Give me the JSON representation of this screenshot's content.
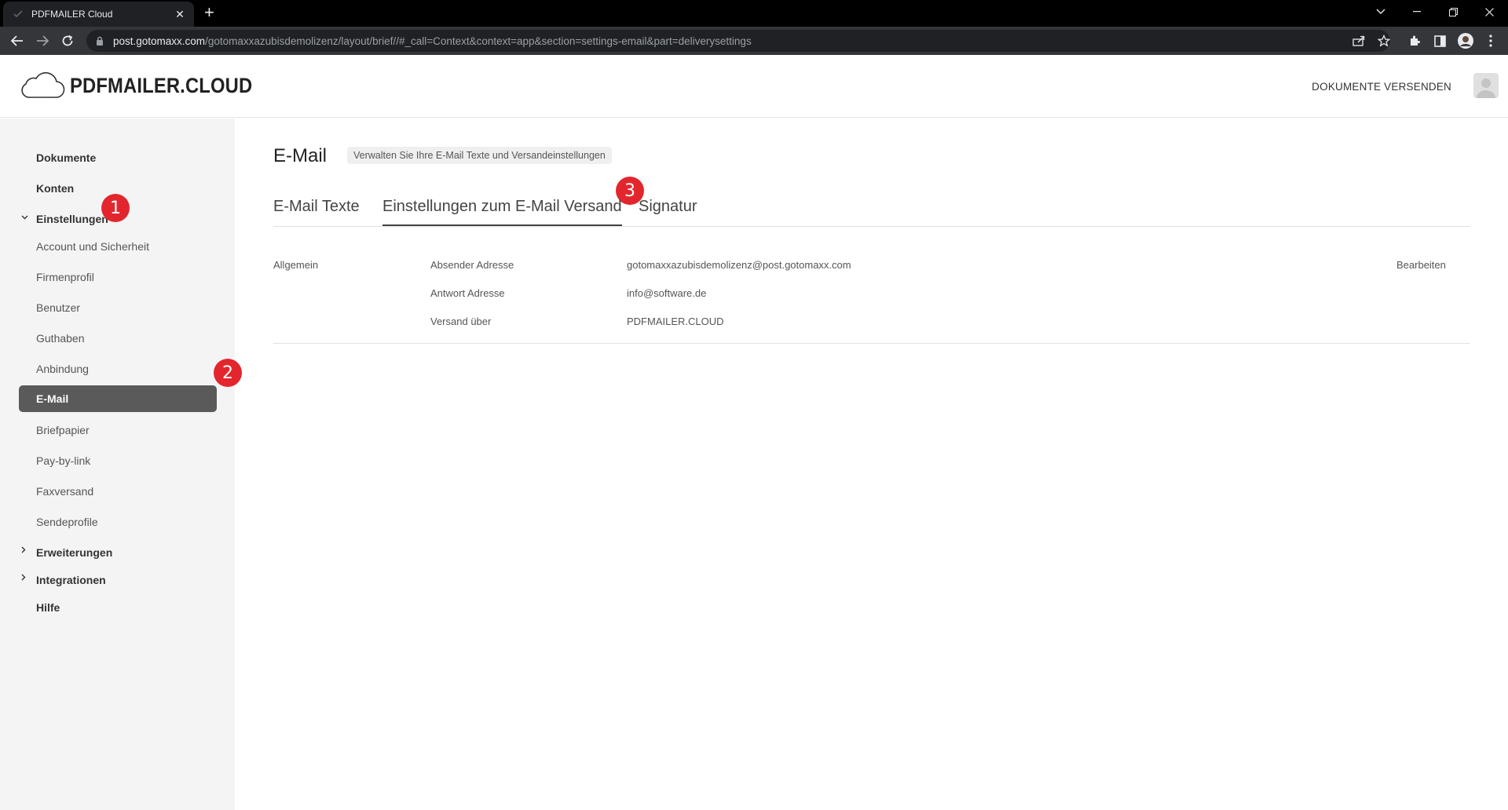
{
  "browser": {
    "tab_title": "PDFMAILER Cloud",
    "url_host": "post.gotomaxx.com",
    "url_path": "/gotomaxxazubisdemolizenz/layout/brief//#_call=Context&context=app&section=settings-email&part=deliverysettings"
  },
  "header": {
    "brand": "PDFMAILER.CLOUD",
    "send_documents": "DOKUMENTE VERSENDEN"
  },
  "sidebar": {
    "items": [
      {
        "label": "Dokumente"
      },
      {
        "label": "Konten"
      },
      {
        "label": "Einstellungen"
      },
      {
        "label": "Account und Sicherheit"
      },
      {
        "label": "Firmenprofil"
      },
      {
        "label": "Benutzer"
      },
      {
        "label": "Guthaben"
      },
      {
        "label": "Anbindung"
      },
      {
        "label": "E-Mail"
      },
      {
        "label": "Briefpapier"
      },
      {
        "label": "Pay-by-link"
      },
      {
        "label": "Faxversand"
      },
      {
        "label": "Sendeprofile"
      },
      {
        "label": "Erweiterungen"
      },
      {
        "label": "Integrationen"
      },
      {
        "label": "Hilfe"
      }
    ]
  },
  "badges": [
    "1",
    "2",
    "3"
  ],
  "main": {
    "title": "E-Mail",
    "hint": "Verwalten Sie Ihre E-Mail Texte und Versandeinstellungen",
    "tabs": [
      {
        "label": "E-Mail Texte"
      },
      {
        "label": "Einstellungen zum E-Mail Versand"
      },
      {
        "label": "Signatur"
      }
    ],
    "section_label": "Allgemein",
    "edit_label": "Bearbeiten",
    "fields": [
      {
        "label": "Absender Adresse",
        "value": "gotomaxxazubisdemolizenz@post.gotomaxx.com"
      },
      {
        "label": "Antwort Adresse",
        "value": "info@software.de"
      },
      {
        "label": "Versand über",
        "value": "PDFMAILER.CLOUD"
      }
    ]
  },
  "colors": {
    "active_nav_bg": "#5a5a5a",
    "badge_red": "#e3262e",
    "sidebar_bg": "#f4f4f4"
  }
}
